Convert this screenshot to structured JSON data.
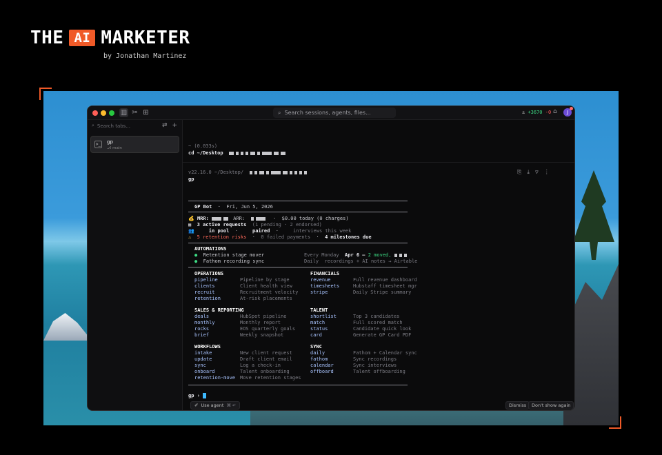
{
  "brand": {
    "left": "THE",
    "box": "AI",
    "right": "MARKETER",
    "byline": "by Jonathan Martinez"
  },
  "window": {
    "search_placeholder": "Search sessions, agents, files...",
    "diff_plus": "+3670",
    "diff_minus": "-0",
    "avatar_letter": "J"
  },
  "sidebar": {
    "search_placeholder": "Search tabs...",
    "item": {
      "name": "gp",
      "branch": "⎇ main"
    }
  },
  "term": {
    "b1_time": "~ (0.033s)",
    "b1_cmd": "cd ~/Desktop",
    "b2_prompt": "v22.16.0 ~/Desktop/",
    "b2_cmd": "gp",
    "gp_title": "GP Bot",
    "gp_date": "Fri, Jun 5, 2026",
    "mrr_label": "MRR:",
    "arr_label": "ARR:",
    "today": "$0.00 today (0 charges)",
    "requests": "3 active requests",
    "requests_detail": "(1 pending · 2 endorsed)",
    "pool": "in pool",
    "paired": "paired",
    "interviews": "interviews this week",
    "risks": "5 retention risks",
    "failed": "0 failed payments",
    "milestones": "4 milestones due",
    "automations_h": "AUTOMATIONS",
    "auto1_name": "Retention stage mover",
    "auto1_sched": "Every Monday",
    "auto1_date": "Apr 6 –",
    "auto1_moved": "2 moved,",
    "auto2_name": "Fathom recording sync",
    "auto2_sched": "Daily",
    "auto2_desc": "recordings + AI notes → Airtable",
    "ops_h": "OPERATIONS",
    "fin_h": "FINANCIALS",
    "ops": [
      {
        "c": "pipeline",
        "d": "Pipeline by stage"
      },
      {
        "c": "clients",
        "d": "Client health view"
      },
      {
        "c": "recruit",
        "d": "Recruitment velocity"
      },
      {
        "c": "retention",
        "d": "At-risk placements"
      }
    ],
    "fin": [
      {
        "c": "revenue",
        "d": "Full revenue dashboard"
      },
      {
        "c": "timesheets",
        "d": "Hubstaff timesheet mgr"
      },
      {
        "c": "stripe",
        "d": "Daily Stripe summary"
      }
    ],
    "sales_h": "SALES & REPORTING",
    "talent_h": "TALENT",
    "sales": [
      {
        "c": "deals",
        "d": "HubSpot pipeline"
      },
      {
        "c": "monthly",
        "d": "Monthly report"
      },
      {
        "c": "rocks",
        "d": "EOS quarterly goals"
      },
      {
        "c": "brief",
        "d": "Weekly snapshot"
      }
    ],
    "talent": [
      {
        "c": "shortlist",
        "d": "Top 3 candidates"
      },
      {
        "c": "match",
        "d": "Full scored match"
      },
      {
        "c": "status",
        "d": "Candidate quick look"
      },
      {
        "c": "card",
        "d": "Generate GP Card PDF"
      }
    ],
    "wf_h": "WORKFLOWS",
    "sync_h": "SYNC",
    "wf": [
      {
        "c": "intake",
        "d": "New client request"
      },
      {
        "c": "update",
        "d": "Draft client email"
      },
      {
        "c": "sync",
        "d": "Log a check-in"
      },
      {
        "c": "onboard",
        "d": "Talent onboarding"
      },
      {
        "c": "retention-move",
        "d": "Move retention stages"
      }
    ],
    "sync": [
      {
        "c": "daily",
        "d": "Fathom + Calendar sync"
      },
      {
        "c": "fathom",
        "d": "Sync recordings"
      },
      {
        "c": "calendar",
        "d": "Sync interviews"
      },
      {
        "c": "offboard",
        "d": "Talent offboarding"
      }
    ],
    "prompt": "gp ›",
    "use_agent": "Use agent",
    "use_agent_keys": "⌘ ↵",
    "dismiss": "Dismiss",
    "dont_show": "Don't show again"
  },
  "colors": {
    "accent": "#f05a28",
    "command": "#a9c4ff",
    "ok": "#3ddc84",
    "risk": "#ff6a5a",
    "cursor": "#3db9ff"
  },
  "icons": [
    "sidebar-icon",
    "tools-icon",
    "grid-icon",
    "search-icon",
    "plus-minus-icon",
    "inbox-icon",
    "filter-icon",
    "plus-icon",
    "terminal-icon",
    "attach-icon",
    "download-icon",
    "funnel-icon",
    "more-icon",
    "money-bag-icon",
    "clipboard-icon",
    "people-icon",
    "warning-icon"
  ]
}
